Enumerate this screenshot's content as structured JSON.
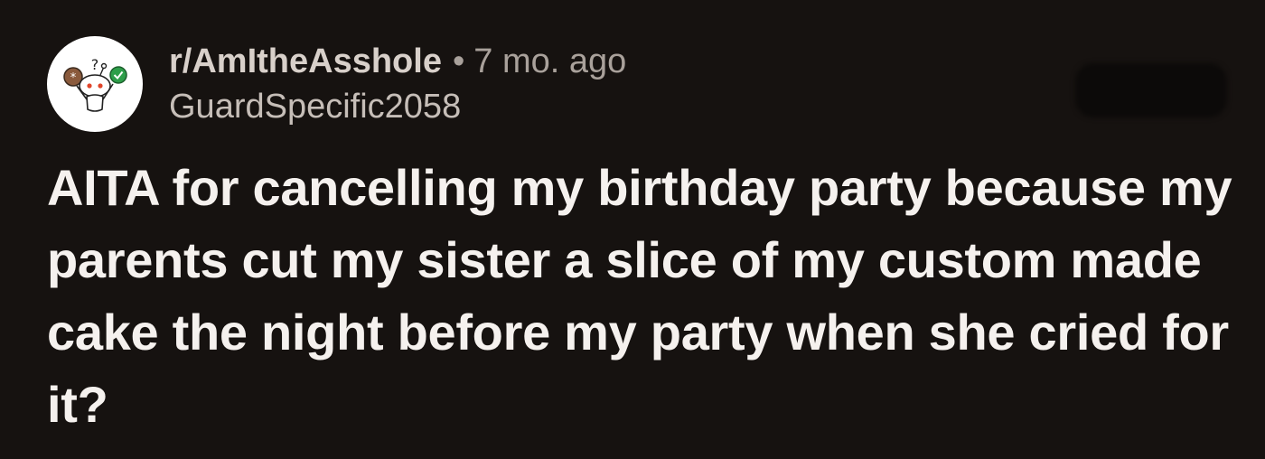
{
  "post": {
    "subreddit": "r/AmItheAsshole",
    "separator": "•",
    "age": "7 mo. ago",
    "author": "GuardSpecific2058",
    "title": "AITA for cancelling my birthday party because my parents cut my sister a slice of my custom made cake the night before my party when she cried for it?"
  },
  "avatar": {
    "icon": "snoo-avatar-icon",
    "background": "#ffffff",
    "badge_colors": [
      "#8a5a3c",
      "#2e9e4a"
    ]
  },
  "colors": {
    "background": "#161210",
    "title": "#f5f1ee",
    "meta": "#a9a19b"
  }
}
